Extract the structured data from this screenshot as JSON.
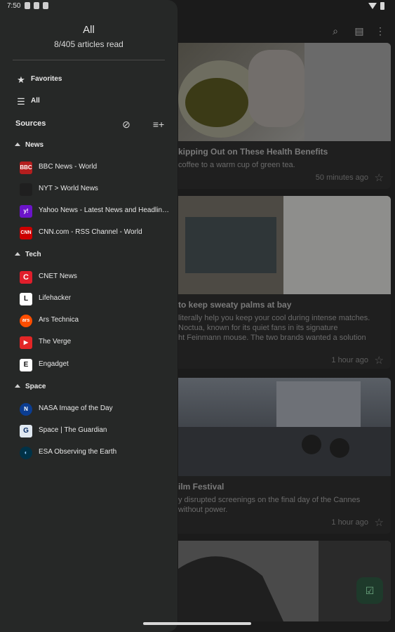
{
  "status": {
    "time": "7:50"
  },
  "drawer": {
    "title": "All",
    "subtitle": "8/405 articles read",
    "favorites_label": "Favorites",
    "all_label": "All",
    "sources_label": "Sources",
    "groups": [
      {
        "label": "News",
        "feeds": [
          {
            "label": "BBC News - World",
            "icon": "bbc-icon",
            "color": "#b41e1e",
            "badge": "BBC"
          },
          {
            "label": "NYT > World News",
            "icon": "nyt-icon",
            "color": "#1f1f1f",
            "badge": ""
          },
          {
            "label": "Yahoo News - Latest News and Headlin…",
            "icon": "yahoo-icon",
            "color": "#6b14c9",
            "badge": "y!"
          },
          {
            "label": "CNN.com - RSS Channel - World",
            "icon": "cnn-icon",
            "color": "#cc0000",
            "badge": "CNN"
          }
        ]
      },
      {
        "label": "Tech",
        "feeds": [
          {
            "label": "CNET News",
            "icon": "cnet-icon",
            "color": "#e01e2b",
            "badge": "C"
          },
          {
            "label": "Lifehacker",
            "icon": "lifehacker-icon",
            "color": "#ffffff",
            "badge": "L"
          },
          {
            "label": "Ars Technica",
            "icon": "ars-icon",
            "color": "#ff4e00",
            "badge": "ars"
          },
          {
            "label": "The Verge",
            "icon": "verge-icon",
            "color": "#e32626",
            "badge": "▶"
          },
          {
            "label": "Engadget",
            "icon": "engadget-icon",
            "color": "#ffffff",
            "badge": "E"
          }
        ]
      },
      {
        "label": "Space",
        "feeds": [
          {
            "label": "NASA Image of the Day",
            "icon": "nasa-icon",
            "color": "#0b3d91",
            "badge": "N"
          },
          {
            "label": "Space | The Guardian",
            "icon": "guardian-icon",
            "color": "#e0e8f0",
            "badge": "G"
          },
          {
            "label": "ESA Observing the Earth",
            "icon": "esa-icon",
            "color": "#003247",
            "badge": "◐"
          }
        ]
      }
    ]
  },
  "articles": [
    {
      "title": "kipping Out on These Health Benefits",
      "summary": "coffee to a warm cup of green tea.",
      "time": "50 minutes ago"
    },
    {
      "title": "to keep sweaty palms at bay",
      "summary": "literally help you keep your cool during intense matches.\nNoctua, known for its quiet fans in its signature\nht Feinmann mouse. The two brands wanted a solution",
      "time": "1 hour ago"
    },
    {
      "title": "ilm Festival",
      "summary": "y disrupted screenings on the final day of the Cannes\nwithout power.",
      "time": "1 hour ago"
    }
  ],
  "colors": {
    "drawer_bg": "#262827",
    "fab_bg": "#1e3a2b"
  }
}
